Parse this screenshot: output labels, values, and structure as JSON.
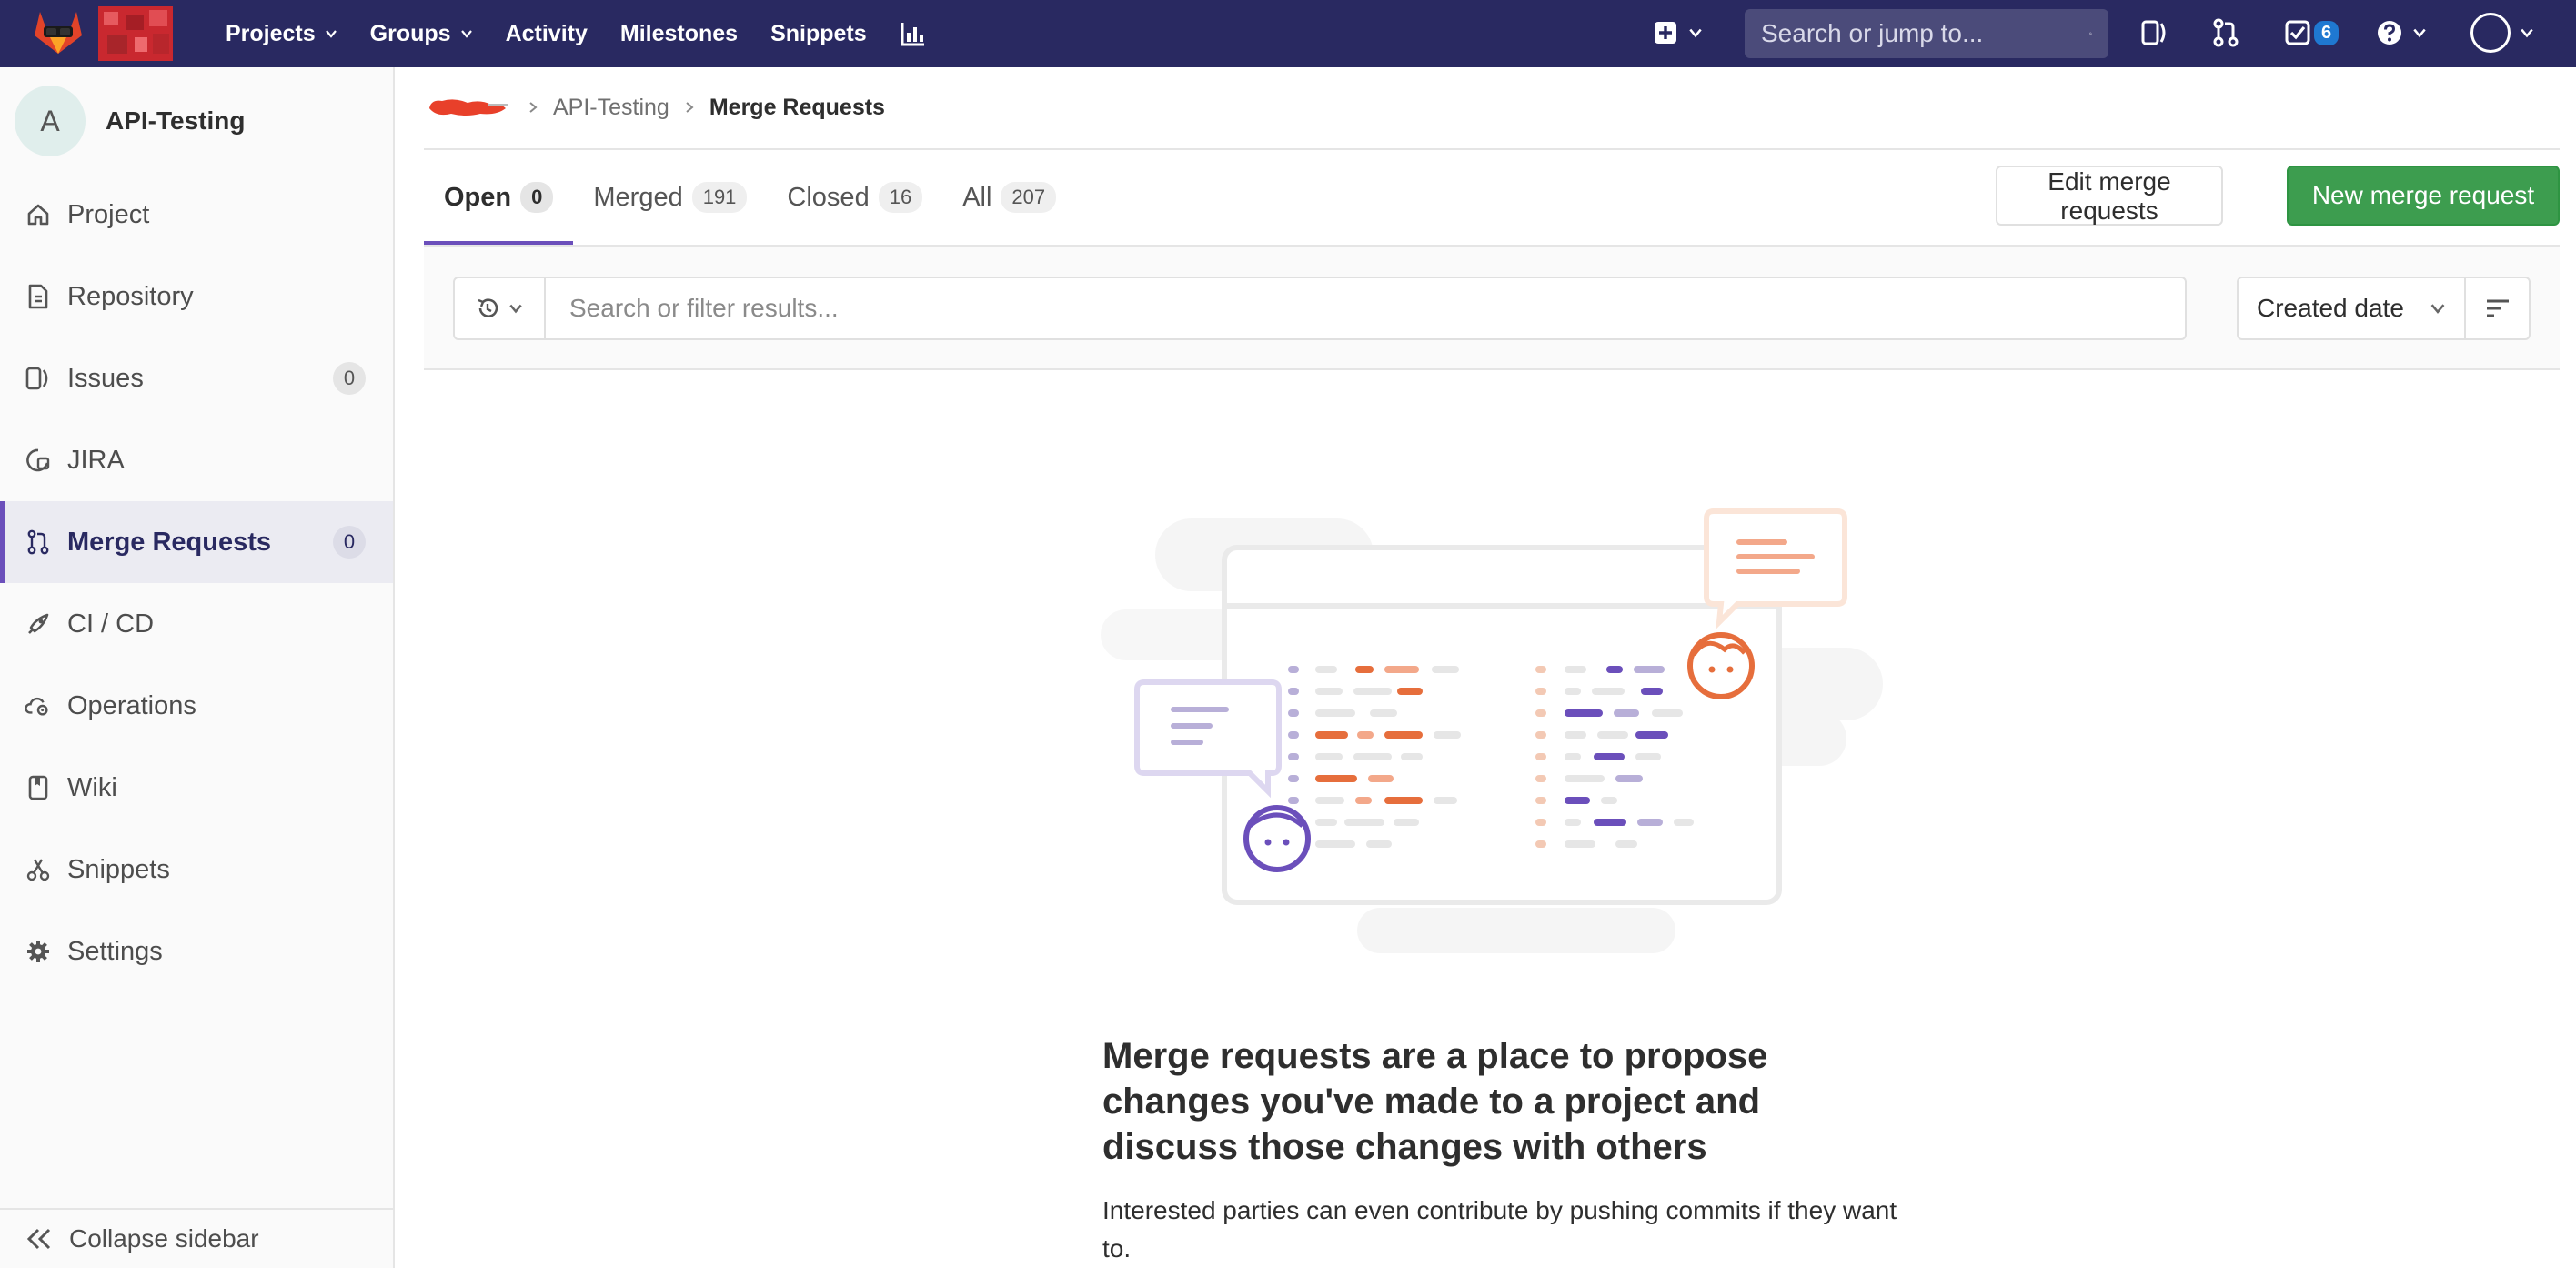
{
  "navbar": {
    "links": [
      {
        "label": "Projects",
        "dropdown": true
      },
      {
        "label": "Groups",
        "dropdown": true
      },
      {
        "label": "Activity",
        "dropdown": false
      },
      {
        "label": "Milestones",
        "dropdown": false
      },
      {
        "label": "Snippets",
        "dropdown": false
      }
    ],
    "search_placeholder": "Search or jump to...",
    "todo_count": "6",
    "background": "#292961"
  },
  "sidebar": {
    "project_initial": "A",
    "project_name": "API-Testing",
    "items": [
      {
        "label": "Project",
        "icon": "home-icon",
        "count": null,
        "active": false
      },
      {
        "label": "Repository",
        "icon": "doc-icon",
        "count": null,
        "active": false
      },
      {
        "label": "Issues",
        "icon": "issues-icon",
        "count": "0",
        "active": false
      },
      {
        "label": "JIRA",
        "icon": "jira-icon",
        "count": null,
        "active": false
      },
      {
        "label": "Merge Requests",
        "icon": "merge-request-icon",
        "count": "0",
        "active": true
      },
      {
        "label": "CI / CD",
        "icon": "rocket-icon",
        "count": null,
        "active": false
      },
      {
        "label": "Operations",
        "icon": "cloud-gear-icon",
        "count": null,
        "active": false
      },
      {
        "label": "Wiki",
        "icon": "book-icon",
        "count": null,
        "active": false
      },
      {
        "label": "Snippets",
        "icon": "scissors-icon",
        "count": null,
        "active": false
      },
      {
        "label": "Settings",
        "icon": "gear-icon",
        "count": null,
        "active": false
      }
    ],
    "collapse_label": "Collapse sidebar"
  },
  "breadcrumb": {
    "project": "API-Testing",
    "current": "Merge Requests"
  },
  "tabs": [
    {
      "label": "Open",
      "count": "0",
      "active": true
    },
    {
      "label": "Merged",
      "count": "191",
      "active": false
    },
    {
      "label": "Closed",
      "count": "16",
      "active": false
    },
    {
      "label": "All",
      "count": "207",
      "active": false
    }
  ],
  "actions": {
    "edit_label": "Edit merge requests",
    "new_label": "New merge request"
  },
  "filter": {
    "placeholder": "Search or filter results...",
    "sort_label": "Created date"
  },
  "empty_state": {
    "title": "Merge requests are a place to propose changes you've made to a project and discuss those changes with others",
    "text": "Interested parties can even contribute by pushing commits if they want to."
  },
  "colors": {
    "accent": "#6b4fbb",
    "success": "#3d9d4f",
    "orange": "#e66e3c"
  }
}
